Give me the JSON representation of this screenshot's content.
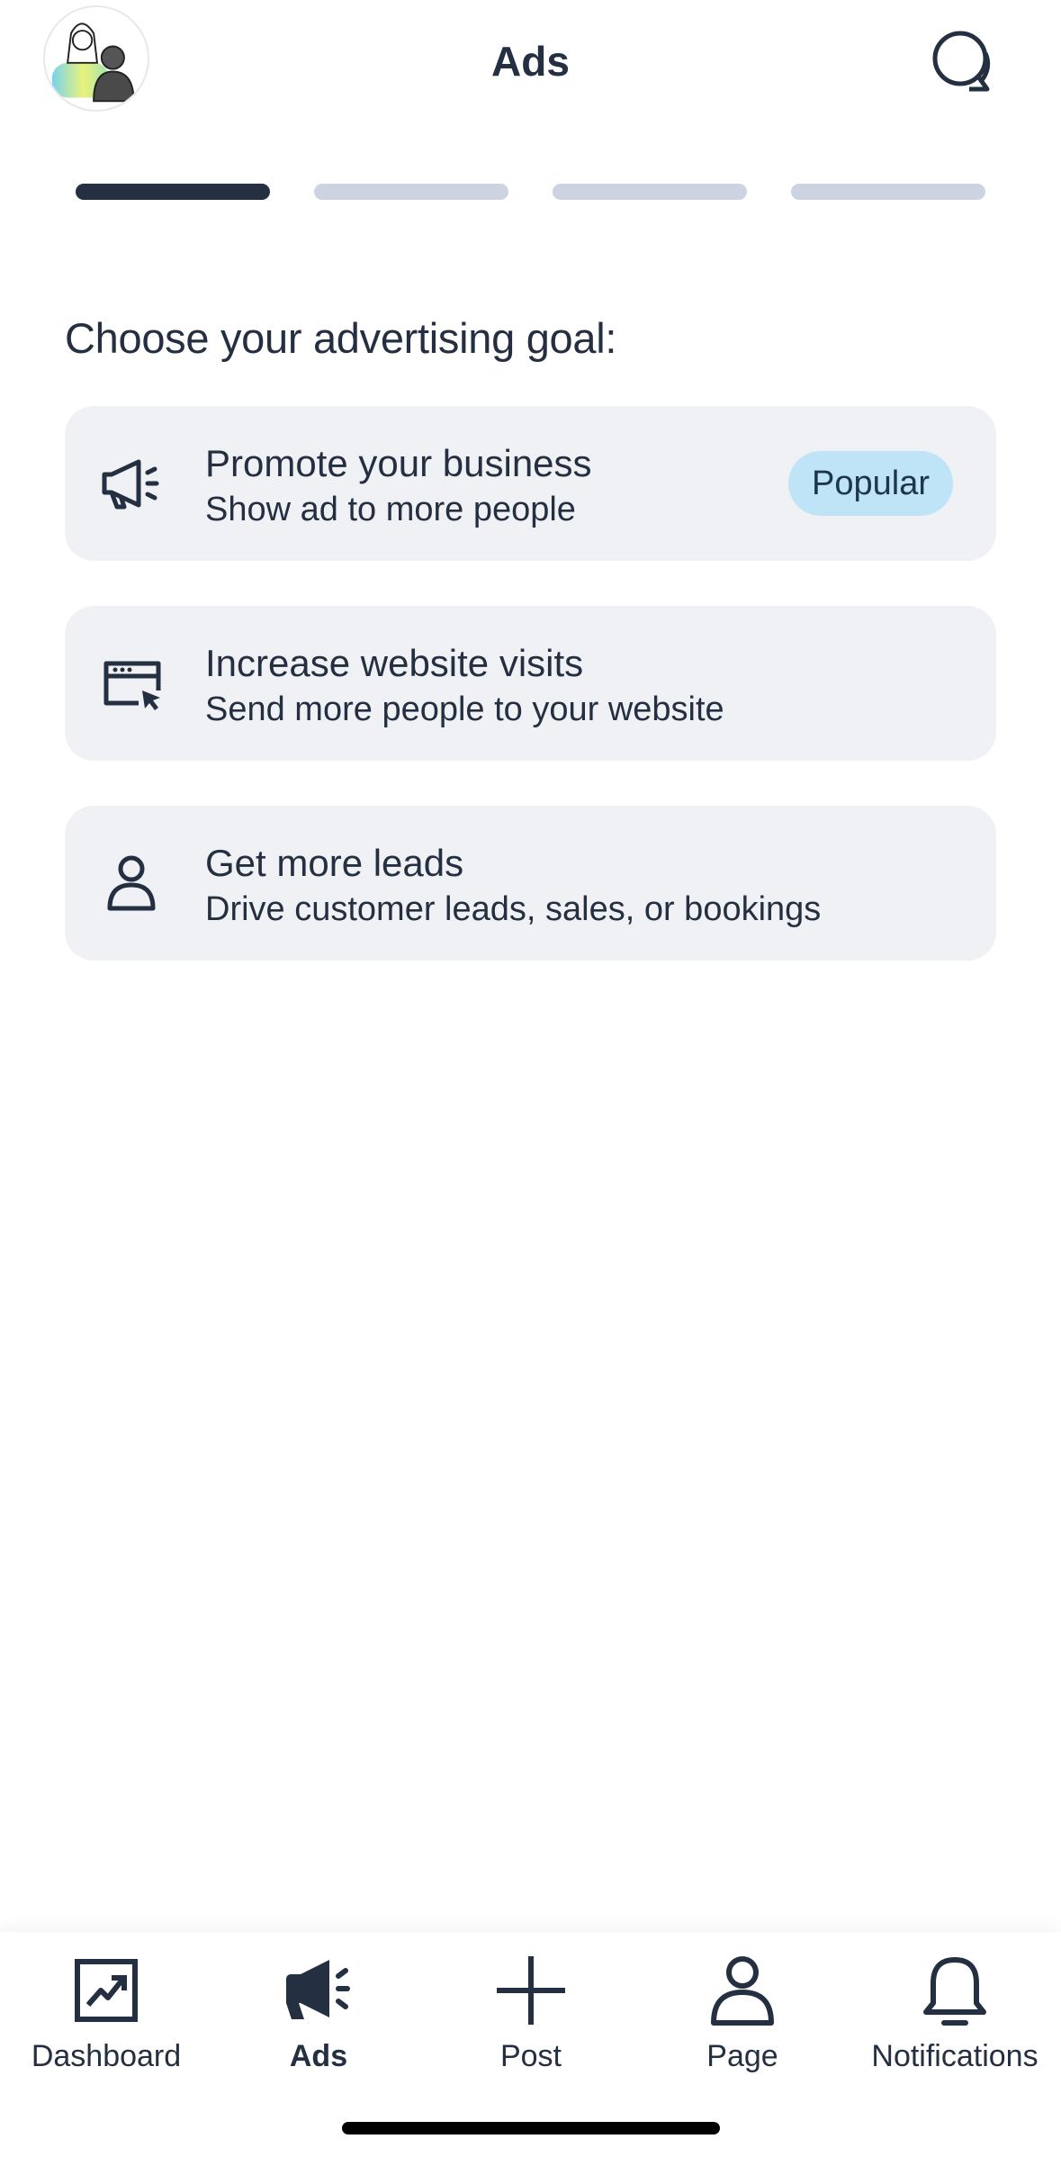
{
  "header": {
    "title": "Ads",
    "avatar_icon": "profile-avatar-illustration",
    "chat_icon": "chat-bubbles-icon"
  },
  "progress": {
    "current_step": 1,
    "total_steps": 4
  },
  "main": {
    "heading": "Choose your advertising goal:",
    "goals": [
      {
        "title": "Promote your business",
        "subtitle": "Show ad to more people",
        "icon": "megaphone-icon",
        "badge": "Popular"
      },
      {
        "title": "Increase website visits",
        "subtitle": "Send more people to your website",
        "icon": "browser-cursor-icon"
      },
      {
        "title": "Get more leads",
        "subtitle": "Drive customer leads, sales, or bookings",
        "icon": "person-icon"
      }
    ]
  },
  "bottom_nav": {
    "items": [
      {
        "label": "Dashboard",
        "icon": "chart-trend-icon",
        "active": false
      },
      {
        "label": "Ads",
        "icon": "megaphone-filled-icon",
        "active": true
      },
      {
        "label": "Post",
        "icon": "plus-icon",
        "active": false
      },
      {
        "label": "Page",
        "icon": "person-icon",
        "active": false
      },
      {
        "label": "Notifications",
        "icon": "bell-icon",
        "active": false
      }
    ]
  },
  "colors": {
    "text": "#243041",
    "progress_active": "#243041",
    "progress_inactive": "#ccd4e2",
    "card_background": "#f0f1f5",
    "badge_background": "#bfe3f7"
  }
}
